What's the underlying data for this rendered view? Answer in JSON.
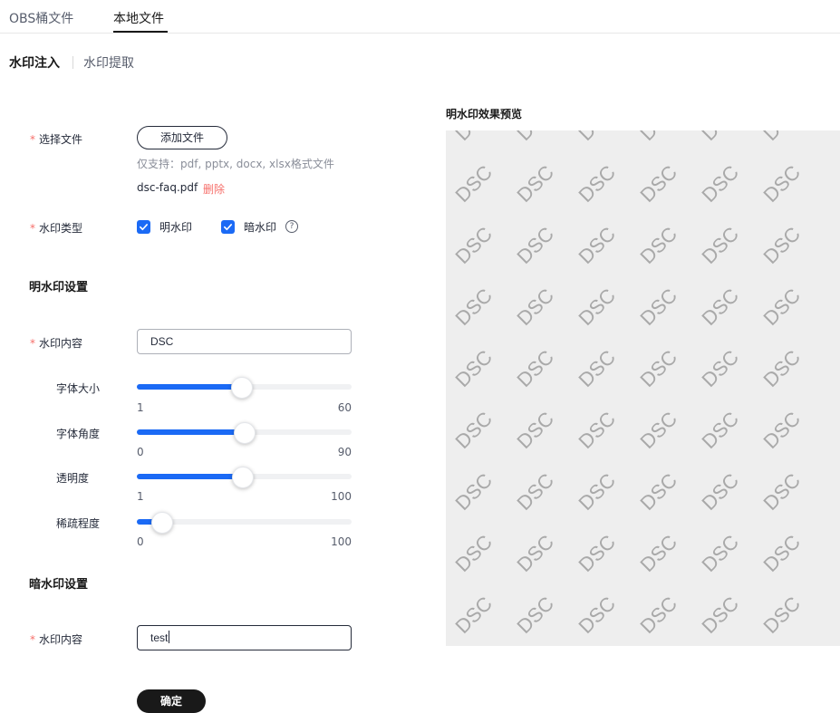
{
  "tabs": {
    "obs": "OBS桶文件",
    "local": "本地文件"
  },
  "subtabs": {
    "inject": "水印注入",
    "extract": "水印提取"
  },
  "form": {
    "required_mark": "*",
    "file_label": "选择文件",
    "add_file_button": "添加文件",
    "support_hint": "仅支持：pdf, pptx, docx, xlsx格式文件",
    "file_name": "dsc-faq.pdf",
    "delete_label": "删除",
    "type_label": "水印类型",
    "visible_checkbox": "明水印",
    "visible_checked": true,
    "dark_checkbox": "暗水印",
    "dark_checked": true,
    "help_icon": "?",
    "visible_section": "明水印设置",
    "content_label": "水印内容",
    "visible_content_value": "DSC",
    "dark_section": "暗水印设置",
    "dark_content_value": "test",
    "confirm_button": "确定"
  },
  "sliders": [
    {
      "label": "字体大小",
      "min": "1",
      "max": "60",
      "value": 30
    },
    {
      "label": "字体角度",
      "min": "0",
      "max": "90",
      "value": 45
    },
    {
      "label": "透明度",
      "min": "1",
      "max": "100",
      "value": 50
    },
    {
      "label": "稀疏程度",
      "min": "0",
      "max": "100",
      "value": 12
    }
  ],
  "preview": {
    "title": "明水印效果预览",
    "watermark_text": "DSC",
    "watermark_angle_deg": 45
  },
  "colors": {
    "accent": "#1b6af5",
    "required": "#f66f6a",
    "primary_button": "#191919",
    "preview_bg": "#eeeeee",
    "watermark": "#a9a9a9"
  },
  "icons": {
    "checkbox": "check-icon",
    "help": "question-circle-icon"
  }
}
